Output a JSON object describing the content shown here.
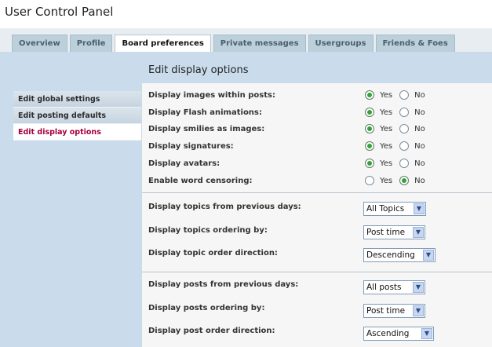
{
  "title": "User Control Panel",
  "tabs": [
    {
      "label": "Overview",
      "active": false
    },
    {
      "label": "Profile",
      "active": false
    },
    {
      "label": "Board preferences",
      "active": true
    },
    {
      "label": "Private messages",
      "active": false
    },
    {
      "label": "Usergroups",
      "active": false
    },
    {
      "label": "Friends & Foes",
      "active": false
    }
  ],
  "sidebar": [
    {
      "label": "Edit global settings",
      "active": false
    },
    {
      "label": "Edit posting defaults",
      "active": false
    },
    {
      "label": "Edit display options",
      "active": true
    }
  ],
  "heading": "Edit display options",
  "yes_label": "Yes",
  "no_label": "No",
  "radio_options": [
    {
      "label": "Display images within posts:",
      "value": "Yes"
    },
    {
      "label": "Display Flash animations:",
      "value": "Yes"
    },
    {
      "label": "Display smilies as images:",
      "value": "Yes"
    },
    {
      "label": "Display signatures:",
      "value": "Yes"
    },
    {
      "label": "Display avatars:",
      "value": "Yes"
    },
    {
      "label": "Enable word censoring:",
      "value": "No"
    }
  ],
  "topic_options": [
    {
      "label": "Display topics from previous days:",
      "value": "All Topics"
    },
    {
      "label": "Display topics ordering by:",
      "value": "Post time"
    },
    {
      "label": "Display topic order direction:",
      "value": "Descending"
    }
  ],
  "post_options": [
    {
      "label": "Display posts from previous days:",
      "value": "All posts"
    },
    {
      "label": "Display posts ordering by:",
      "value": "Post time"
    },
    {
      "label": "Display post order direction:",
      "value": "Ascending"
    }
  ]
}
